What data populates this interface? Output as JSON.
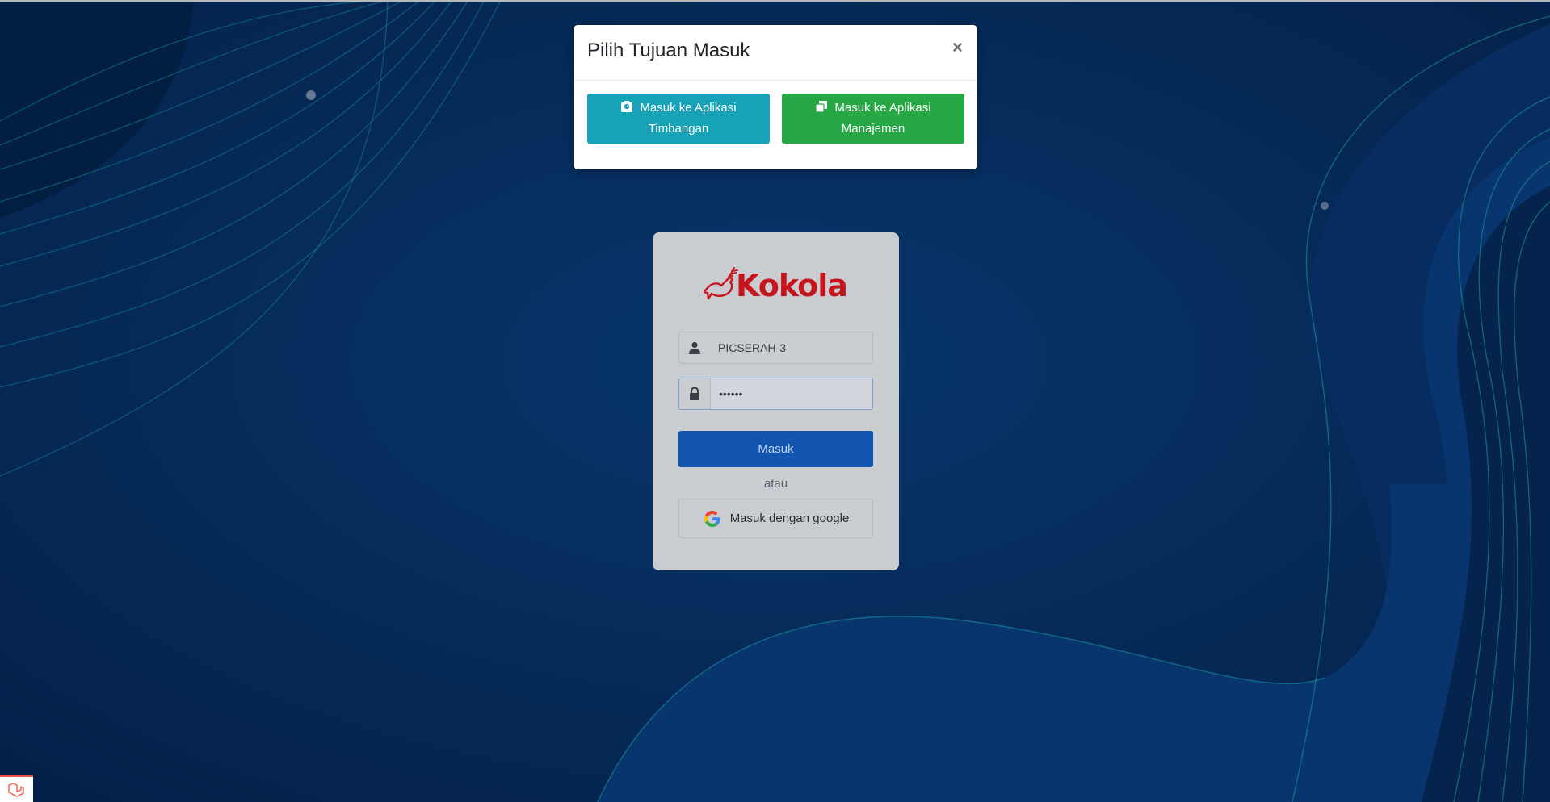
{
  "modal": {
    "title": "Pilih Tujuan Masuk",
    "close_label": "×",
    "buttons": [
      {
        "label": "Masuk ke Aplikasi Timbangan",
        "icon": "scale-icon",
        "color": "#17a2b8"
      },
      {
        "label": "Masuk ke Aplikasi Manajemen",
        "icon": "documents-icon",
        "color": "#28a745"
      }
    ]
  },
  "login": {
    "logo_text": "Kokola",
    "username": {
      "value": "PICSERAH-3",
      "icon": "user-icon"
    },
    "password": {
      "value": "••••••",
      "icon": "lock-icon"
    },
    "submit_label": "Masuk",
    "separator": "atau",
    "google_label": "Masuk dengan google"
  },
  "colors": {
    "background": "#073a7a",
    "brand_red": "#c8141c",
    "primary": "#1155b0"
  }
}
